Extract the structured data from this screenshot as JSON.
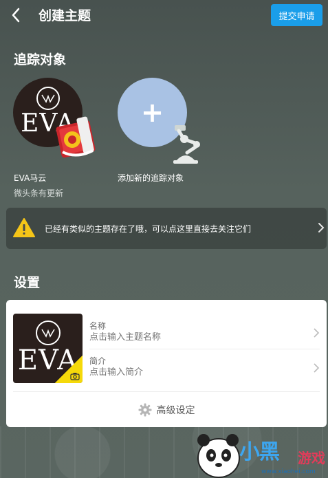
{
  "header": {
    "title": "创建主题",
    "submit_label": "提交申请"
  },
  "track": {
    "section_title": "追踪对象",
    "target": {
      "name": "EVA马云",
      "source": "微头条有更新",
      "avatar_text": "EVA"
    },
    "add_label": "添加新的追踪对象"
  },
  "notice": {
    "text": "已经有类似的主题存在了哦，可以点这里直接去关注它们"
  },
  "settings": {
    "section_title": "设置",
    "cover_text": "EVA",
    "name_label": "名称",
    "name_placeholder": "点击输入主题名称",
    "intro_label": "简介",
    "intro_placeholder": "点击输入简介",
    "advanced_label": "高级设定"
  },
  "watermark": {
    "main": "小黑",
    "sub": "游戏",
    "url": "www.xiaohei.com"
  },
  "colors": {
    "accent": "#1a9eea",
    "add_circle": "#a9c2e4",
    "badge": "#f5d90a",
    "warning": "#f5c518"
  }
}
